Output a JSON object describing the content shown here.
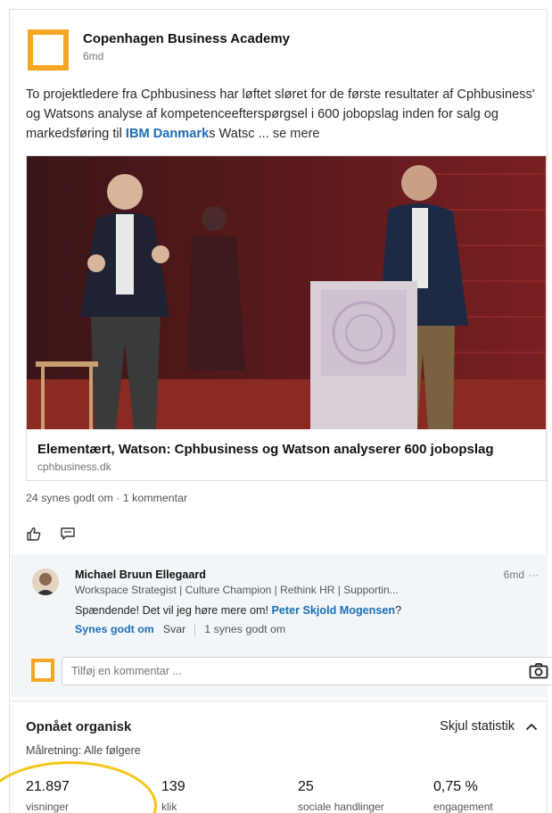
{
  "post": {
    "company_name": "Copenhagen Business Academy",
    "time_ago": "6md",
    "text_part1": "To projektledere fra Cphbusiness har løftet sløret for de første resultater af Cphbusiness' og Watsons analyse af kompetenceefterspørgsel i 600 jobopslag inden for salg og markedsføring til ",
    "text_tag": "IBM Danmark",
    "text_part2": "s Watsc ...",
    "see_more": "se mere"
  },
  "link_preview": {
    "title": "Elementært, Watson: Cphbusiness og Watson analyserer 600 jobopslag",
    "domain": "cphbusiness.dk"
  },
  "social_counts": "24 synes godt om · 1 kommentar",
  "actions": {
    "like_icon": "thumbs-up-icon",
    "comment_icon": "comment-icon"
  },
  "comment": {
    "author": "Michael Bruun Ellegaard",
    "headline": "Workspace Strategist | Culture Champion | Rethink HR | Supportin...",
    "time_ago": "6md",
    "more": "···",
    "text_before": "Spændende! Det vil jeg høre mere om! ",
    "mention": "Peter Skjold Mogensen",
    "text_after": "?",
    "like_label": "Synes godt om",
    "reply_label": "Svar",
    "like_count": "1 synes godt om"
  },
  "add_comment": {
    "placeholder": "Tilføj en kommentar ..."
  },
  "stats": {
    "title": "Opnået organisk",
    "toggle_label": "Skjul statistik",
    "targeting": "Målretning: Alle følgere",
    "metrics": [
      {
        "value": "21.897",
        "label": "visninger"
      },
      {
        "value": "139",
        "label": "klik"
      },
      {
        "value": "25",
        "label": "sociale handlinger"
      },
      {
        "value": "0,75 %",
        "label": "engagement"
      }
    ]
  },
  "colors": {
    "brand_orange": "#f5a623",
    "link_blue": "#1b6fb5",
    "highlight_yellow": "#f5c518"
  }
}
